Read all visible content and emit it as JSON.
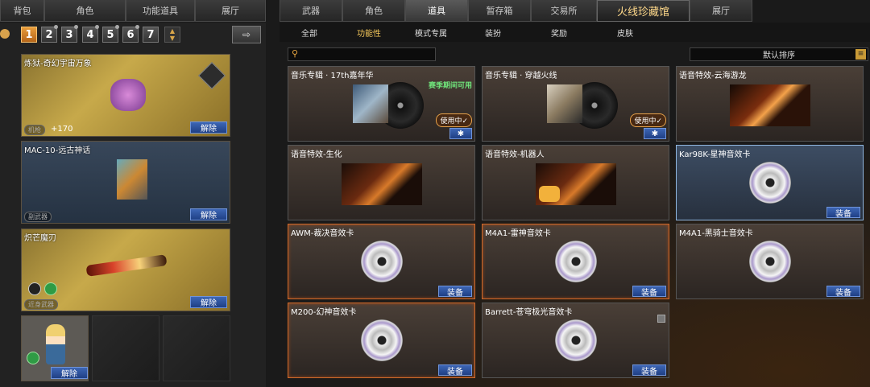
{
  "left_tabs": [
    "背包",
    "角色",
    "功能道具",
    "展厅"
  ],
  "right_tabs": [
    "武器",
    "角色",
    "道具",
    "暂存箱",
    "交易所",
    "火线珍藏馆",
    "展厅"
  ],
  "sub_tabs": [
    "全部",
    "功能性",
    "模式专属",
    "装扮",
    "奖励",
    "皮肤"
  ],
  "bag_numbers": [
    "1",
    "2",
    "3",
    "4",
    "5",
    "6",
    "7"
  ],
  "equipped": [
    {
      "title": "炼狱-奇幻宇宙万象",
      "tag": "机枪",
      "bonus": "+170",
      "button": "解除"
    },
    {
      "title": "MAC-10-远古神话",
      "tag": "副武器",
      "button": "解除"
    },
    {
      "title": "炽芒魔刃",
      "tag": "近身武器",
      "button": "解除"
    },
    {
      "button": "解除"
    }
  ],
  "search": {
    "placeholder": ""
  },
  "sort": {
    "label": "默认排序"
  },
  "items": [
    {
      "title": "音乐专辑 · 17th嘉年华",
      "note": "赛季期间可用",
      "status": "使用中✓"
    },
    {
      "title": "音乐专辑 · 穿越火线",
      "status": "使用中✓"
    },
    {
      "title": "语音特效-云海游龙"
    },
    {
      "title": "语音特效-生化"
    },
    {
      "title": "语音特效-机器人"
    },
    {
      "title": "Kar98K-星神音效卡",
      "button": "装备"
    },
    {
      "title": "AWM-裁决音效卡",
      "button": "装备"
    },
    {
      "title": "M4A1-雷神音效卡",
      "button": "装备"
    },
    {
      "title": "M4A1-黑骑士音效卡",
      "button": "装备"
    },
    {
      "title": "M200-幻神音效卡",
      "button": "装备"
    },
    {
      "title": "Barrett-苍穹极光音效卡",
      "button": "装备"
    }
  ]
}
